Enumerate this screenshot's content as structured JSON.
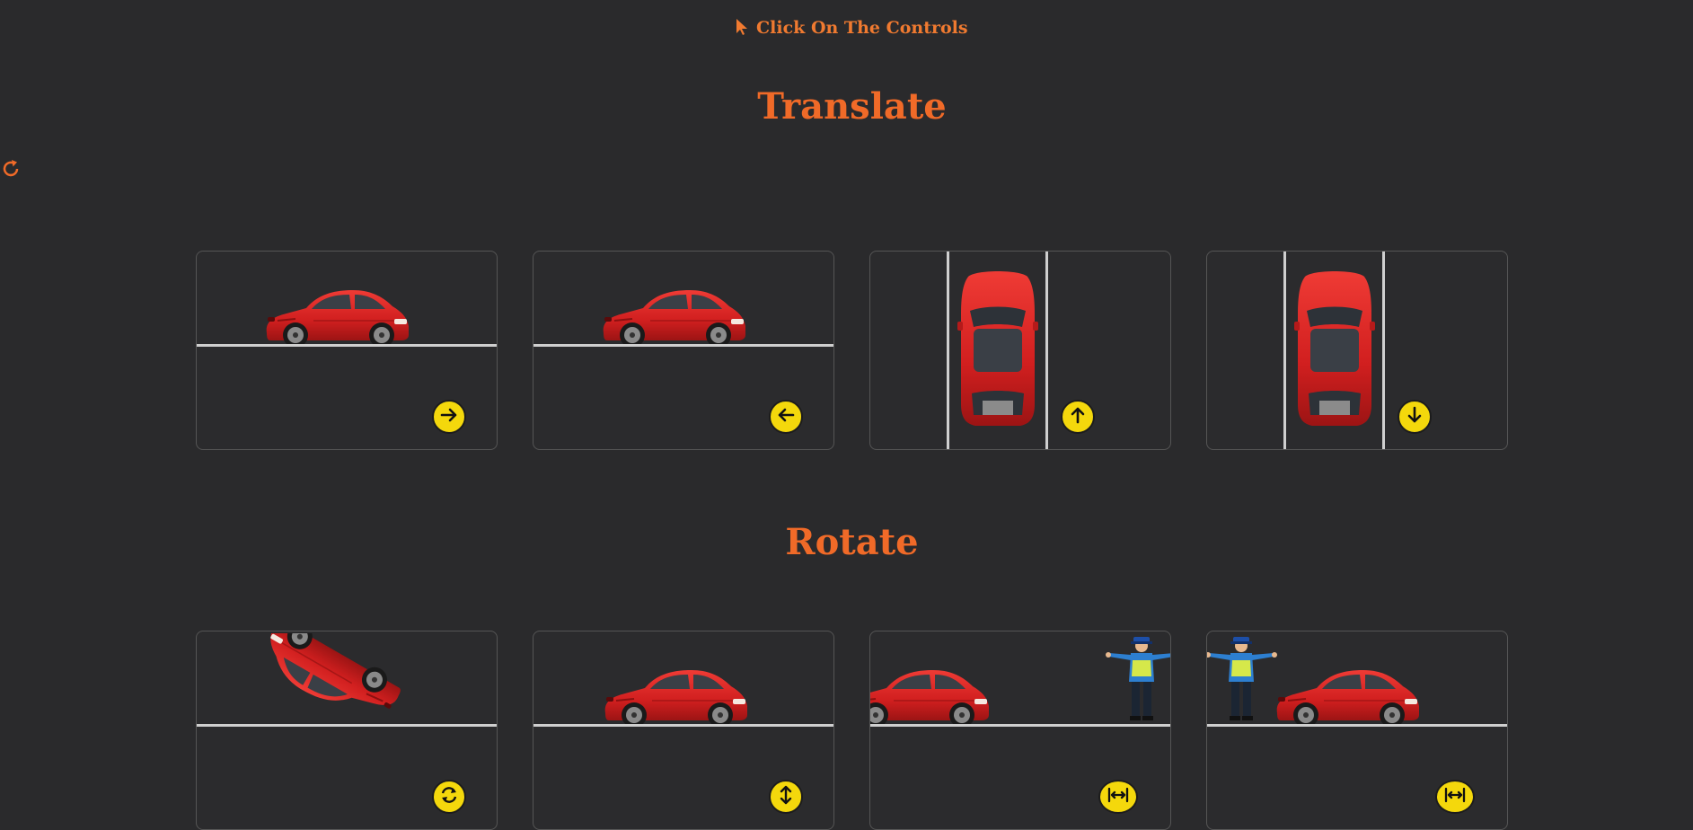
{
  "hint": {
    "text": "Click On The Controls",
    "icon": "cursor-icon"
  },
  "sections": {
    "translate": {
      "title": "Translate"
    },
    "rotate": {
      "title": "Rotate"
    }
  },
  "controls": {
    "reload_icon": "reload-icon",
    "translate": [
      "arrow-right-icon",
      "arrow-left-icon",
      "arrow-up-icon",
      "arrow-down-icon"
    ],
    "rotate": [
      "rotate-icon",
      "flip-vertical-icon",
      "flip-horizontal-icon",
      "flip-horizontal-icon"
    ]
  },
  "colors": {
    "accent": "#f06a28",
    "control": "#f4d80c",
    "background": "#2a2a2c",
    "car": "#d92525"
  }
}
